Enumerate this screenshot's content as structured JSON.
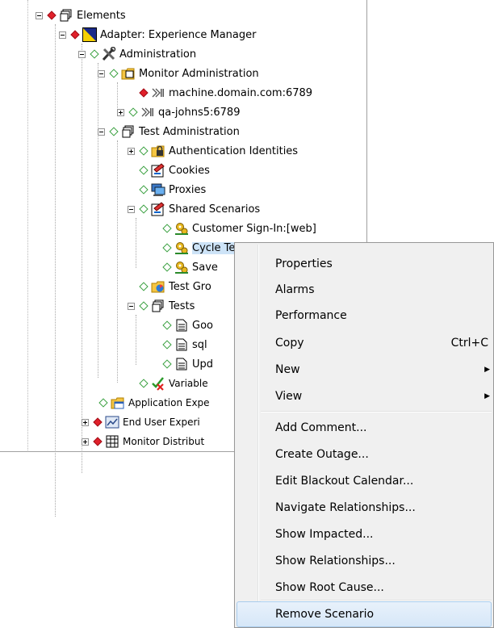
{
  "tree": {
    "elements": "Elements",
    "adapter": "Adapter: Experience Manager",
    "administration": "Administration",
    "monitor_administration": "Monitor Administration",
    "machine": "machine.domain.com:6789",
    "qa_johns": "qa-johns5:6789",
    "test_administration": "Test Administration",
    "authentication_identities": "Authentication Identities",
    "cookies": "Cookies",
    "proxies": "Proxies",
    "shared_scenarios": "Shared Scenarios",
    "customer_sign_in": "Customer Sign-In:[web]",
    "cycle_test": "Cycle Test:[web]",
    "save": "Save",
    "test_groups": "Test Gro",
    "tests": "Tests",
    "goo": "Goo",
    "sql": "sql",
    "upd": "Upd",
    "variables": "Variable",
    "application_experience": "Application Expe",
    "end_user_experience": "End User Experi",
    "monitor_distribution": "Monitor Distribut"
  },
  "menu": {
    "properties": "Properties",
    "alarms": "Alarms",
    "performance": "Performance",
    "copy": "Copy",
    "copy_shortcut": "Ctrl+C",
    "new": "New",
    "view": "View",
    "add_comment": "Add Comment...",
    "create_outage": "Create Outage...",
    "edit_blackout": "Edit Blackout Calendar...",
    "navigate_relationships": "Navigate Relationships...",
    "show_impacted": "Show Impacted...",
    "show_relationships": "Show Relationships...",
    "show_root_cause": "Show Root Cause...",
    "remove_scenario": "Remove Scenario"
  },
  "colors": {
    "status_critical": "#e0202a",
    "status_normal": "#3aa040",
    "menu_highlight": "#d6e7f8"
  }
}
